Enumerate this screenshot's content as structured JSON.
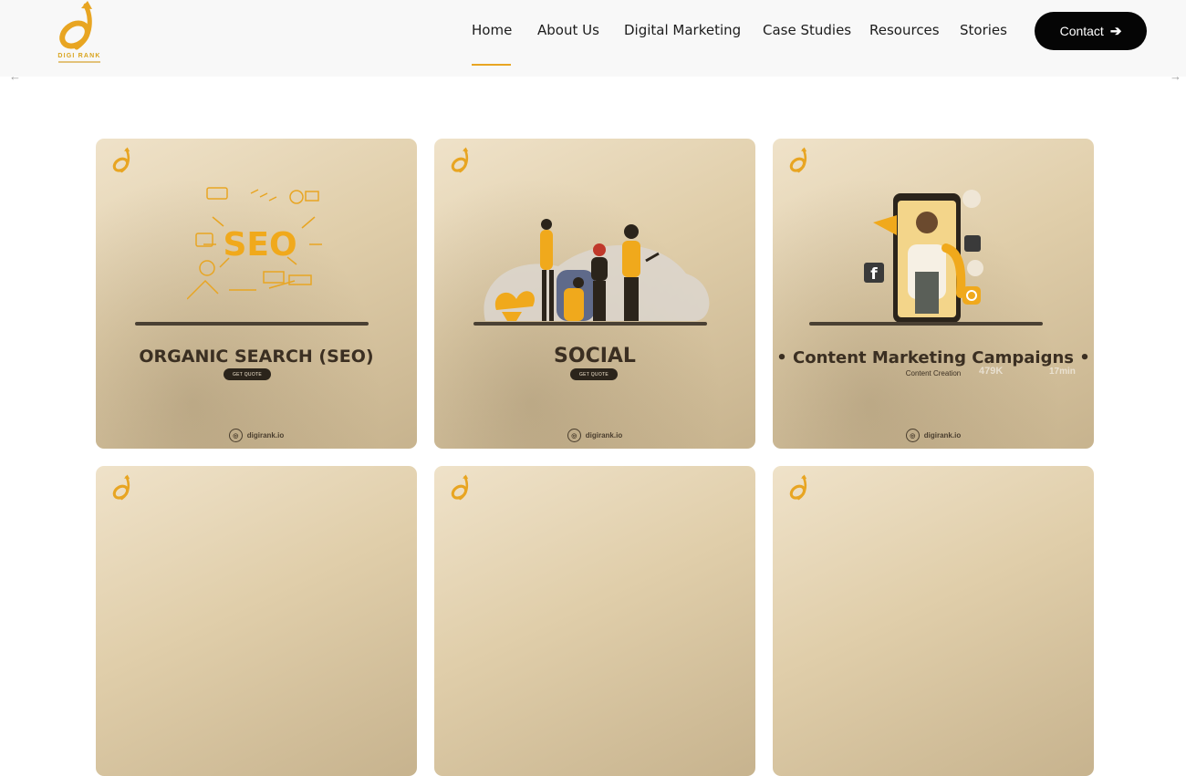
{
  "brand": {
    "name": "DIGI RANK",
    "logo_icon": "digirank-logo-icon"
  },
  "nav": {
    "items": [
      {
        "label": "Home",
        "active": true
      },
      {
        "label": "About Us"
      },
      {
        "label": "Digital Marketing"
      },
      {
        "label": "Case Studies"
      },
      {
        "label": "Resources"
      },
      {
        "label": "Stories"
      }
    ],
    "contact_label": "Contact",
    "contact_icon": "arrow-right-icon"
  },
  "carousel": {
    "prev_icon": "arrow-left-icon",
    "next_icon": "arrow-right-icon"
  },
  "cards": [
    {
      "title": "ORGANIC SEARCH (SEO)",
      "button": "GET QUOTE",
      "illustration_text": "SEO",
      "footer": "digirank.io"
    },
    {
      "title": "SOCIAL",
      "button": "GET QUOTE",
      "footer": "digirank.io"
    },
    {
      "title": "• Content Marketing Campaigns •",
      "subtitle": "Content Creation",
      "stats": [
        "479K",
        "17min"
      ],
      "footer": "digirank.io"
    }
  ],
  "colors": {
    "accent": "#e8a522",
    "button_bg": "#050505",
    "card_dark": "#3b2f22"
  }
}
